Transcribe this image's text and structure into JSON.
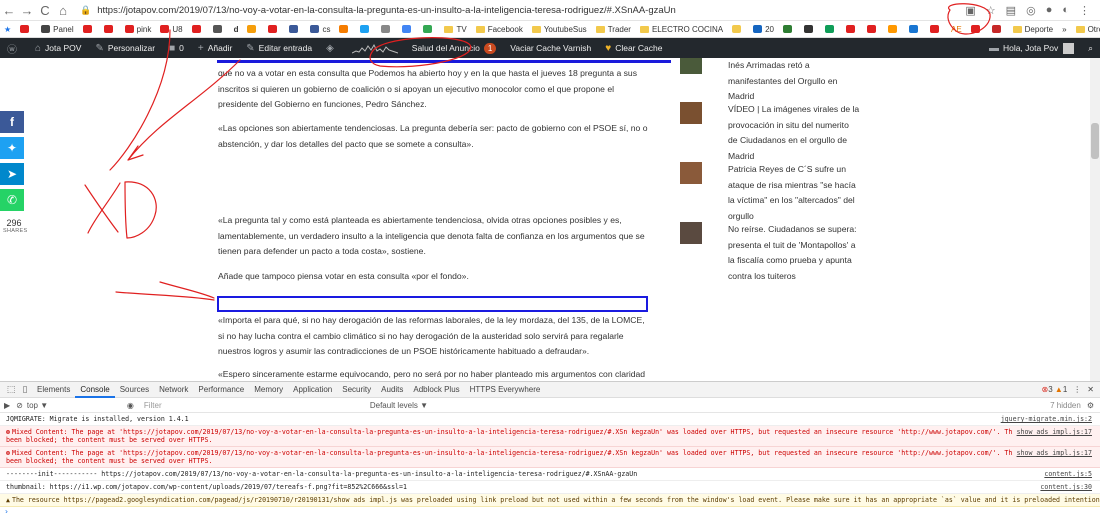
{
  "browser": {
    "url": "https://jotapov.com/2019/07/13/no-voy-a-votar-en-la-consulta-la-pregunta-es-un-insulto-a-la-inteligencia-teresa-rodriguez/#.XSnAA-gzaUn",
    "bookmarks": [
      "Panel",
      "pink",
      "U8",
      "d",
      "cs",
      "TV",
      "Facebook",
      "YoutubeSus",
      "Trader",
      "ELECTRO COCINA",
      "20",
      "AE",
      "Deporte"
    ],
    "other_bookmarks": "Otros marcadores"
  },
  "admin_bar": {
    "site": "Jota POV",
    "customize": "Personalizar",
    "comments": "0",
    "add": "Añadir",
    "edit": "Editar entrada",
    "ad_health": "Salud del Anuncio",
    "ad_health_count": "1",
    "varnish": "Vaciar Cache Varnish",
    "clear_cache": "Clear Cache",
    "greeting": "Hola, Jota Pov"
  },
  "article": {
    "p1": "que no va a votar en esta consulta que Podemos ha abierto hoy y en la que hasta el jueves 18 pregunta a sus inscritos si quieren un gobierno de coalición o si apoyan un ejecutivo monocolor como el que propone el presidente del Gobierno en funciones, Pedro Sánchez.",
    "p2": "«Las opciones son abiertamente tendenciosas. La pregunta debería ser: pacto de gobierno con el PSOE sí, no o abstención, y dar los detalles del pacto que se somete a consulta».",
    "p3": "«La pregunta tal y como está planteada es abiertamente tendenciosa, olvida otras opciones posibles y es, lamentablemente, un verdadero insulto a la inteligencia que denota falta de confianza en los argumentos que se tienen para defender un pacto a toda costa», sostiene.",
    "p4": "Añade que tampoco piensa votar en esta consulta «por el fondo».",
    "p5": "«Importa el para qué, si no hay derogación de las reformas laborales, de la ley mordaza, del 135, de la LOMCE, si no hay lucha contra el cambio climático si no hay derogación de la austeridad solo servirá para regalarle nuestros logros y asumir las contradicciones de un PSOE históricamente habituado a defraudar».",
    "p6": "«Espero sinceramente estarme equivocando, pero no será por no haber planteado mis argumentos con claridad"
  },
  "sidebar": {
    "items": [
      {
        "text": "Inés Arrimadas retó a manifestantes del Orgullo en Madrid"
      },
      {
        "text": "VÍDEO | La imágenes virales de la provocación in situ del numerito de Ciudadanos en el orgullo de Madrid"
      },
      {
        "text": "Patricia Reyes de C´S sufre un ataque de risa mientras \"se hacía la víctima\" en los \"altercados\" del orgullo"
      },
      {
        "text": "No reírse. Ciudadanos se supera: presenta el tuit de 'Montapollos' a la fiscalía como prueba y apunta contra los tuiteros"
      }
    ]
  },
  "share": {
    "count": "296",
    "label": "SHARES",
    "colors": {
      "facebook": "#3b5998",
      "twitter": "#1da1f2",
      "telegram": "#0088cc",
      "whatsapp": "#25d366"
    }
  },
  "annotation": {
    "text": "XD",
    "color": "#e02020"
  },
  "devtools": {
    "tabs": [
      "Elements",
      "Console",
      "Sources",
      "Network",
      "Performance",
      "Memory",
      "Application",
      "Security",
      "Audits",
      "Adblock Plus",
      "HTTPS Everywhere"
    ],
    "active_tab": "Console",
    "error_count": "3",
    "warning_count": "1",
    "context": "top",
    "filter_placeholder": "Filter",
    "levels": "Default levels ▼",
    "hidden": "7 hidden",
    "lines": [
      {
        "type": "log",
        "text": "JQMIGRATE: Migrate is installed, version 1.4.1",
        "src": "jquery-migrate.min.js:2"
      },
      {
        "type": "error",
        "text": "Mixed Content: The page at 'https://jotapov.com/2019/07/13/no-voy-a-votar-en-la-consulta-la-pregunta-es-un-insulto-a-la-inteligencia-teresa-rodriguez/#.XSn kegzaUn' was loaded over HTTPS, but requested an insecure resource 'http://www.jotapov.com/'. This request has been blocked; the content must be served over HTTPS.",
        "src": "show ads impl.js:17"
      },
      {
        "type": "error",
        "text": "Mixed Content: The page at 'https://jotapov.com/2019/07/13/no-voy-a-votar-en-la-consulta-la-pregunta-es-un-insulto-a-la-inteligencia-teresa-rodriguez/#.XSn kegzaUn' was loaded over HTTPS, but requested an insecure resource 'http://www.jotapov.com/'. This request has been blocked; the content must be served over HTTPS.",
        "src": "show ads impl.js:17"
      },
      {
        "type": "log",
        "text": "--------init----------- https://jotapov.com/2019/07/13/no-voy-a-votar-en-la-consulta-la-pregunta-es-un-insulto-a-la-inteligencia-teresa-rodriguez/#.XSnAA-gzaUn",
        "src": "content.js:5"
      },
      {
        "type": "log",
        "text": "thumbnail: https://i1.wp.com/jotapov.com/wp-content/uploads/2019/07/tereafs-f.png?fit=852%2C666&ssl=1",
        "src": "content.js:30"
      },
      {
        "type": "warn",
        "text": "The resource https://pagead2.googlesyndication.com/pagead/js/r20190710/r20190131/show ads impl.js was preloaded using link preload but not used within a few seconds from the window's load event. Please make sure it has an appropriate `as` value and it is preloaded intentionally.",
        "src": ""
      }
    ]
  }
}
